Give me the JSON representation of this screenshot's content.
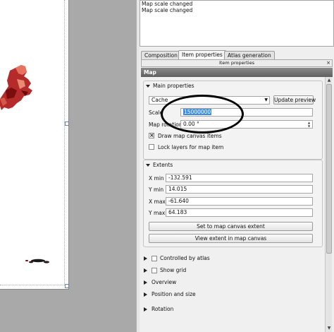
{
  "log": {
    "lines": [
      "Map scale changed",
      "Map scale changed"
    ]
  },
  "tabs": [
    {
      "label": "Composition",
      "active": false
    },
    {
      "label": "Item properties",
      "active": true
    },
    {
      "label": "Atlas generation",
      "active": false
    }
  ],
  "dock": {
    "title": "Item properties",
    "close_glyph": "×"
  },
  "section_header": "Map",
  "main_properties": {
    "title": "Main properties",
    "preview_mode": "Cache",
    "update_preview_label": "Update preview",
    "scale_label": "Scale",
    "scale_value": "15000000",
    "rotation_label": "Map rotation",
    "rotation_value": "0.00 °",
    "draw_canvas_items_label": "Draw map canvas items",
    "draw_canvas_items_checked": true,
    "lock_layers_label": "Lock layers for map item",
    "lock_layers_checked": false
  },
  "extents": {
    "title": "Extents",
    "rows": [
      {
        "label": "X min",
        "value": "-132.591"
      },
      {
        "label": "Y min",
        "value": "14.015"
      },
      {
        "label": "X max",
        "value": "-61.640"
      },
      {
        "label": "Y max",
        "value": "64.183"
      }
    ],
    "set_canvas_label": "Set to map canvas extent",
    "view_canvas_label": "View extent in map canvas"
  },
  "collapsed_sections": [
    {
      "label": "Controlled by atlas",
      "has_checkbox": true
    },
    {
      "label": "Show grid",
      "has_checkbox": true
    },
    {
      "label": "Overview",
      "has_checkbox": false
    },
    {
      "label": "Position and size",
      "has_checkbox": false
    },
    {
      "label": "Rotation",
      "has_checkbox": false
    }
  ],
  "colors": {
    "map_dark": "#7a0d0d",
    "map_mid": "#b52a2a",
    "map_light": "#e6735f",
    "selection": "#3d8ee0",
    "header_bg": "#6f6f6f"
  }
}
